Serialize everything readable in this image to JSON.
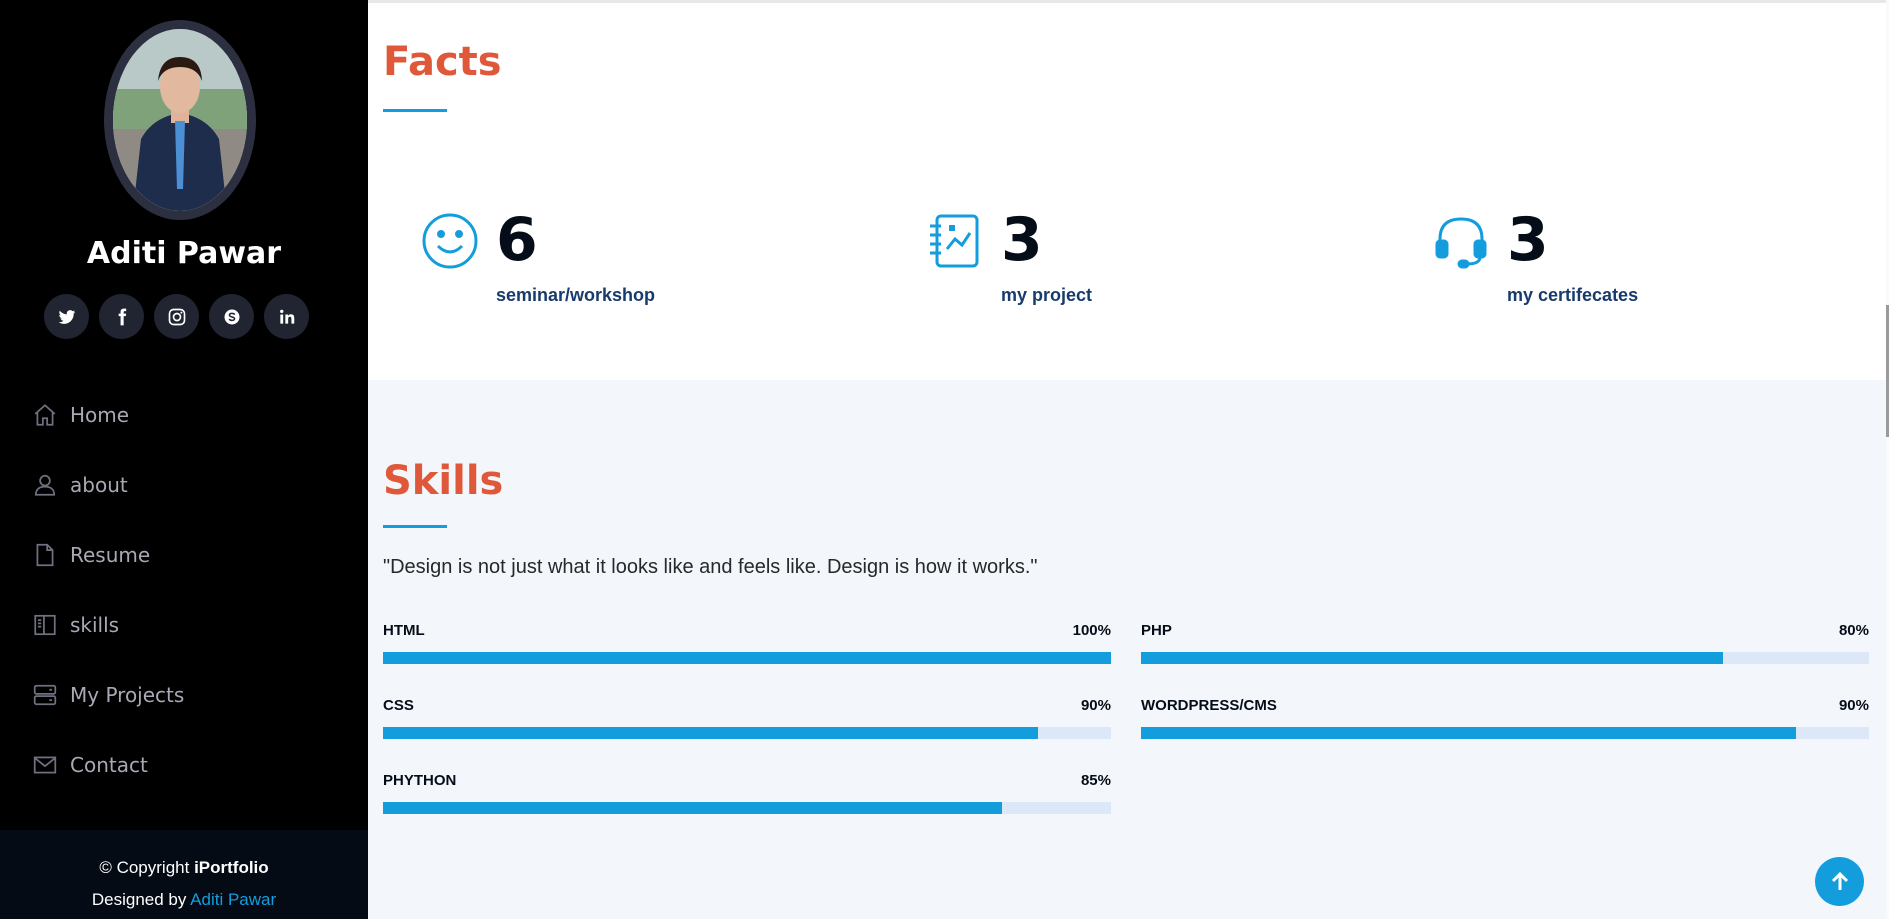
{
  "profile": {
    "name": "Aditi Pawar",
    "socials": [
      {
        "icon": "twitter-icon"
      },
      {
        "icon": "facebook-icon"
      },
      {
        "icon": "instagram-icon"
      },
      {
        "icon": "skype-icon"
      },
      {
        "icon": "linkedin-icon"
      }
    ]
  },
  "nav": {
    "items": [
      {
        "label": "Home",
        "icon": "home-icon"
      },
      {
        "label": "about",
        "icon": "person-icon"
      },
      {
        "label": "Resume",
        "icon": "file-icon"
      },
      {
        "label": "skills",
        "icon": "book-icon"
      },
      {
        "label": "My Projects",
        "icon": "server-icon"
      },
      {
        "label": "Contact",
        "icon": "envelope-icon"
      }
    ]
  },
  "footer": {
    "copyright_prefix": "© Copyright ",
    "brand": "iPortfolio",
    "designed_prefix": "Designed by ",
    "designer": "Aditi Pawar"
  },
  "facts": {
    "title": "Facts",
    "items": [
      {
        "number": "6",
        "label": "seminar/workshop",
        "icon": "smile-icon"
      },
      {
        "number": "3",
        "label": "my project",
        "icon": "journal-icon"
      },
      {
        "number": "3",
        "label": "my certifecates",
        "icon": "headset-icon"
      }
    ]
  },
  "skills": {
    "title": "Skills",
    "quote": "\"Design is not just what it looks like and feels like. Design is how it works.\"",
    "items": [
      {
        "name": "HTML",
        "percent_label": "100%",
        "value": 100
      },
      {
        "name": "PHP",
        "percent_label": "80%",
        "value": 80
      },
      {
        "name": "CSS",
        "percent_label": "90%",
        "value": 90
      },
      {
        "name": "WORDPRESS/CMS",
        "percent_label": "90%",
        "value": 90
      },
      {
        "name": "PHYTHON",
        "percent_label": "85%",
        "value": 85
      }
    ]
  },
  "colors": {
    "accent": "#149ddd",
    "heading": "#e0583a",
    "sidebar": "#000000"
  }
}
